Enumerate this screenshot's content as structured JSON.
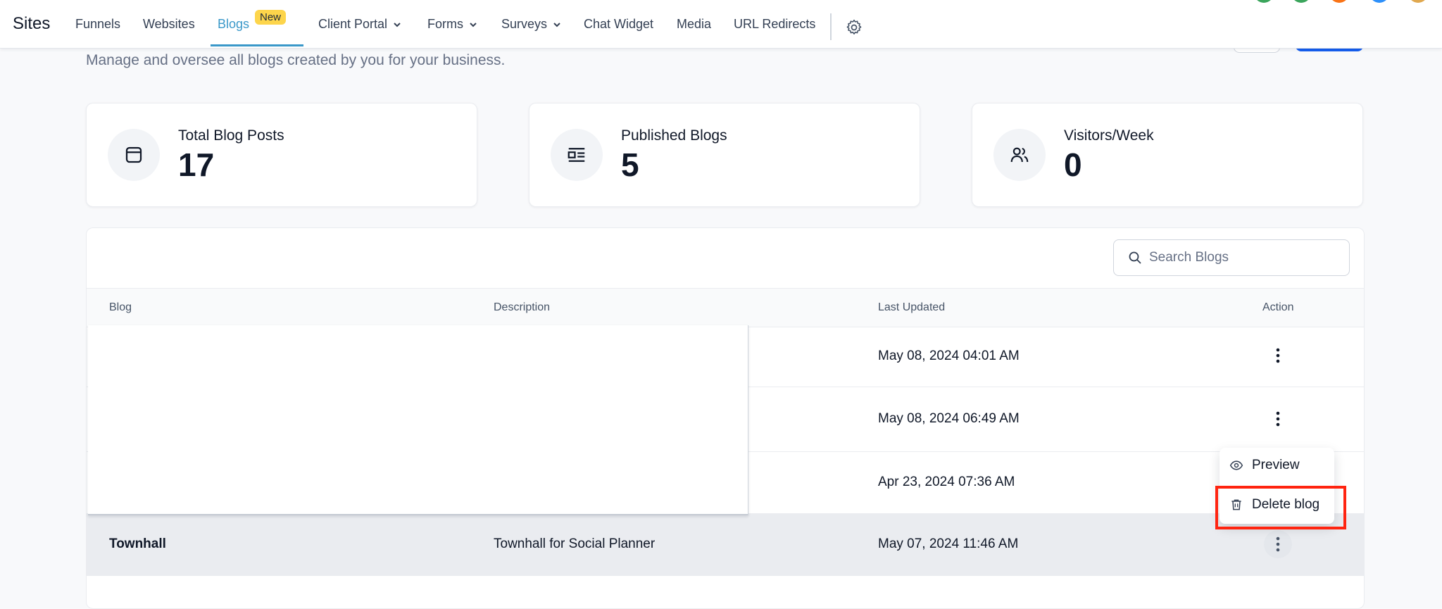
{
  "nav": {
    "brand": "Sites",
    "items": [
      {
        "label": "Funnels"
      },
      {
        "label": "Websites"
      },
      {
        "label": "Blogs",
        "badge": "New",
        "active": true
      },
      {
        "label": "Client Portal",
        "dropdown": true
      },
      {
        "label": "Forms",
        "dropdown": true
      },
      {
        "label": "Surveys",
        "dropdown": true
      },
      {
        "label": "Chat Widget"
      },
      {
        "label": "Media"
      },
      {
        "label": "URL Redirects"
      }
    ]
  },
  "page": {
    "subtitle": "Manage and oversee all blogs created by you for your business."
  },
  "stats": [
    {
      "label": "Total Blog Posts",
      "value": "17",
      "icon": "calendar-icon"
    },
    {
      "label": "Published Blogs",
      "value": "5",
      "icon": "newspaper-icon"
    },
    {
      "label": "Visitors/Week",
      "value": "0",
      "icon": "users-icon"
    }
  ],
  "search": {
    "placeholder": "Search Blogs"
  },
  "table": {
    "headers": {
      "blog": "Blog",
      "description": "Description",
      "last_updated": "Last Updated",
      "action": "Action"
    },
    "rows": [
      {
        "blog": "",
        "description": "",
        "last_updated": "May 08, 2024 04:01 AM"
      },
      {
        "blog": "",
        "description": "",
        "last_updated": "May 08, 2024 06:49 AM"
      },
      {
        "blog": "",
        "description": "",
        "last_updated": "Apr 23, 2024 07:36 AM"
      },
      {
        "blog": "Townhall",
        "description": "Townhall for Social Planner",
        "last_updated": "May 07, 2024 11:46 AM"
      }
    ]
  },
  "menu": {
    "preview": "Preview",
    "delete": "Delete blog"
  },
  "colors": {
    "accent": "#3a98c9",
    "badge": "#fdd54b",
    "primary_button": "#155eef",
    "highlight": "#ff2410"
  }
}
